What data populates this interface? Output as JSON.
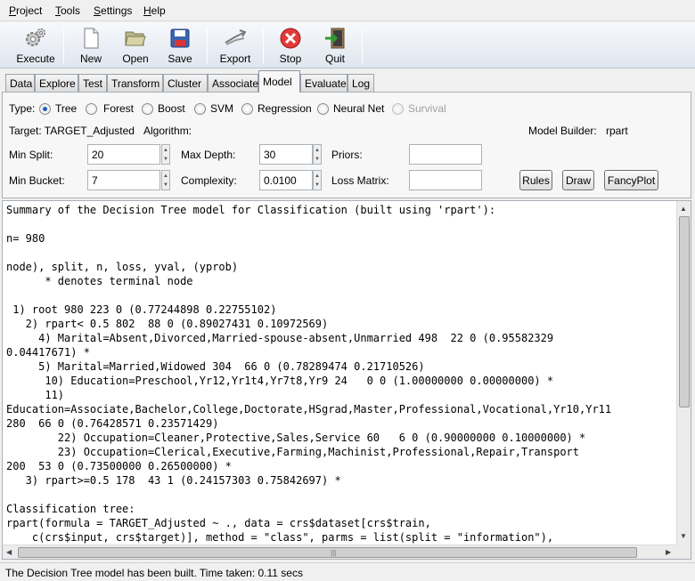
{
  "menu": [
    "Project",
    "Tools",
    "Settings",
    "Help"
  ],
  "toolbar": {
    "execute": "Execute",
    "new": "New",
    "open": "Open",
    "save": "Save",
    "export": "Export",
    "stop": "Stop",
    "quit": "Quit"
  },
  "tabs": [
    "Data",
    "Explore",
    "Test",
    "Transform",
    "Cluster",
    "Associate",
    "Model",
    "Evaluate",
    "Log"
  ],
  "active_tab": "Model",
  "model": {
    "type_label": "Type:",
    "types": [
      "Tree",
      "Forest",
      "Boost",
      "SVM",
      "Regression",
      "Neural Net",
      "Survival"
    ],
    "selected_type": "Tree",
    "target_label": "Target: TARGET_Adjusted",
    "algorithm_label": "Algorithm:",
    "builder_label": "Model Builder:",
    "builder_value": "rpart",
    "min_split_label": "Min Split:",
    "min_split": "20",
    "max_depth_label": "Max Depth:",
    "max_depth": "30",
    "priors_label": "Priors:",
    "min_bucket_label": "Min Bucket:",
    "min_bucket": "7",
    "complexity_label": "Complexity:",
    "complexity": "0.0100",
    "loss_matrix_label": "Loss Matrix:",
    "rules_button": "Rules",
    "draw_button": "Draw",
    "fancyplot_button": "FancyPlot"
  },
  "output": {
    "lines": [
      "Summary of the Decision Tree model for Classification (built using 'rpart'):",
      "",
      "n= 980",
      "",
      "node), split, n, loss, yval, (yprob)",
      "      * denotes terminal node",
      "",
      " 1) root 980 223 0 (0.77244898 0.22755102)",
      "   2) rpart< 0.5 802  88 0 (0.89027431 0.10972569)",
      "     4) Marital=Absent,Divorced,Married-spouse-absent,Unmarried 498  22 0 (0.95582329",
      "0.04417671) *",
      "     5) Marital=Married,Widowed 304  66 0 (0.78289474 0.21710526)",
      "      10) Education=Preschool,Yr12,Yr1t4,Yr7t8,Yr9 24   0 0 (1.00000000 0.00000000) *",
      "      11)",
      "Education=Associate,Bachelor,College,Doctorate,HSgrad,Master,Professional,Vocational,Yr10,Yr11",
      "280  66 0 (0.76428571 0.23571429)",
      "        22) Occupation=Cleaner,Protective,Sales,Service 60   6 0 (0.90000000 0.10000000) *",
      "        23) Occupation=Clerical,Executive,Farming,Machinist,Professional,Repair,Transport",
      "200  53 0 (0.73500000 0.26500000) *",
      "   3) rpart>=0.5 178  43 1 (0.24157303 0.75842697) *",
      "",
      "Classification tree:",
      "rpart(formula = TARGET_Adjusted ~ ., data = crs$dataset[crs$train,",
      "    c(crs$input, crs$target)], method = \"class\", parms = list(split = \"information\"),"
    ]
  },
  "status": "The Decision Tree model has been built. Time taken: 0.11 secs"
}
